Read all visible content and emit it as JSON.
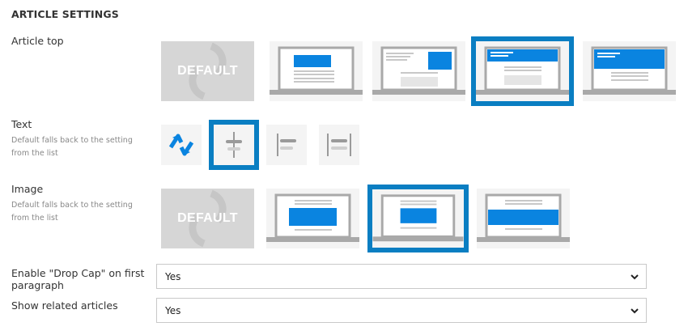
{
  "section": {
    "title": "ARTICLE SETTINGS"
  },
  "article_top": {
    "label": "Article top",
    "options": [
      {
        "name": "default",
        "text": "DEFAULT",
        "selected": false
      },
      {
        "name": "centered-block",
        "selected": false
      },
      {
        "name": "right-block",
        "selected": false
      },
      {
        "name": "header-band",
        "selected": true
      },
      {
        "name": "full-header",
        "selected": false
      }
    ]
  },
  "text": {
    "label": "Text",
    "hint": "Default falls back to the setting from the list",
    "options": [
      {
        "name": "default-arrows",
        "icon": "sync-icon",
        "selected": false
      },
      {
        "name": "align-center",
        "icon": "align-center-icon",
        "selected": true
      },
      {
        "name": "align-left",
        "icon": "align-left-icon",
        "selected": false
      },
      {
        "name": "align-justify",
        "icon": "align-justify-icon",
        "selected": false
      }
    ]
  },
  "image": {
    "label": "Image",
    "hint": "Default falls back to the setting from the list",
    "options": [
      {
        "name": "default",
        "text": "DEFAULT",
        "selected": false
      },
      {
        "name": "medium",
        "selected": false
      },
      {
        "name": "small",
        "selected": true
      },
      {
        "name": "full-width",
        "selected": false
      }
    ]
  },
  "drop_cap": {
    "label": "Enable \"Drop Cap\" on first paragraph",
    "value": "Yes"
  },
  "related": {
    "label": "Show related articles",
    "value": "Yes"
  },
  "colors": {
    "accent": "#0a7ec2",
    "blue": "#0a84e0",
    "tile": "#f4f4f4",
    "default_tile": "#d6d6d6"
  }
}
